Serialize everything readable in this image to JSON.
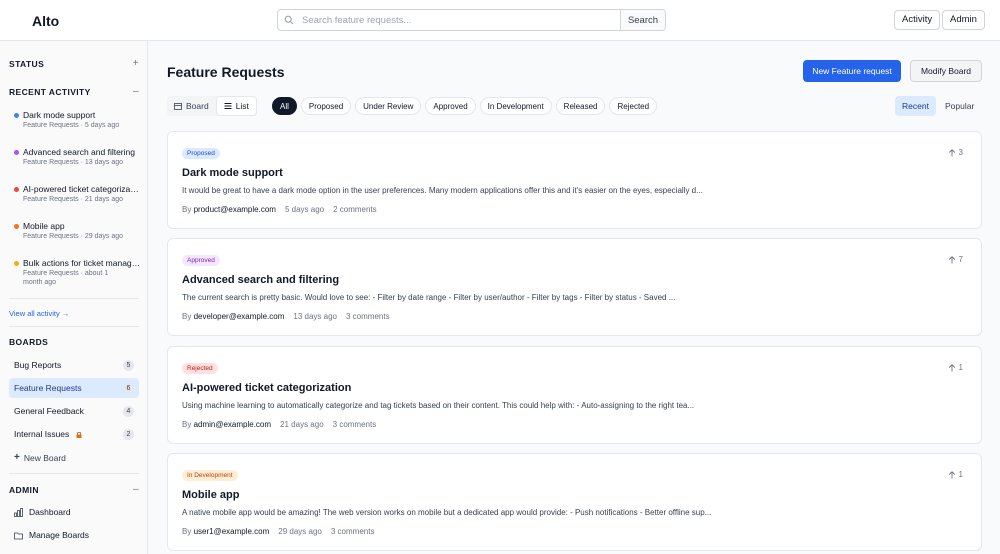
{
  "header": {
    "logo": "Alto",
    "search_placeholder": "Search feature requests...",
    "search_button": "Search",
    "activity_button": "Activity",
    "admin_button": "Admin"
  },
  "sidebar": {
    "status_label": "STATUS",
    "status_toggle": "+",
    "recent_label": "RECENT ACTIVITY",
    "recent_toggle": "–",
    "activity": [
      {
        "title": "Dark mode support",
        "sub": "Feature Requests · 5 days ago",
        "color": "#3b82f6"
      },
      {
        "title": "Advanced search and filtering",
        "sub": "Feature Requests · 13 days ago",
        "color": "#a855f7"
      },
      {
        "title": "AI-powered ticket categorization",
        "sub": "Feature Requests · 21 days ago",
        "color": "#ef4444"
      },
      {
        "title": "Mobile app",
        "sub": "Feature Requests · 29 days ago",
        "color": "#f97316"
      },
      {
        "title": "Bulk actions for ticket management",
        "sub": "Feature Requests · about 1 month ago",
        "color": "#eab308"
      }
    ],
    "view_all": "View all activity →",
    "boards_label": "BOARDS",
    "boards": [
      {
        "name": "Bug Reports",
        "count": "5"
      },
      {
        "name": "Feature Requests",
        "count": "6"
      },
      {
        "name": "General Feedback",
        "count": "4"
      },
      {
        "name": "Internal Issues",
        "count": "2"
      }
    ],
    "new_board": "New Board",
    "admin_label": "ADMIN",
    "admin_toggle": "–",
    "admin_items": [
      {
        "label": "Dashboard"
      },
      {
        "label": "Manage Boards"
      }
    ]
  },
  "main": {
    "title": "Feature Requests",
    "new_button": "New Feature request",
    "modify_button": "Modify Board",
    "view_board": "Board",
    "view_list": "List",
    "filters": [
      "All",
      "Proposed",
      "Under Review",
      "Approved",
      "In Development",
      "Released",
      "Rejected"
    ],
    "sort_recent": "Recent",
    "sort_popular": "Popular",
    "cards": [
      {
        "status": "Proposed",
        "status_bg": "#dbeafe",
        "status_fg": "#1d4ed8",
        "title": "Dark mode support",
        "desc": "It would be great to have a dark mode option in the user preferences. Many modern applications offer this and it's easier on the eyes, especially d...",
        "author": "product@example.com",
        "time": "5 days ago",
        "comments": "2 comments",
        "votes": "3"
      },
      {
        "status": "Approved",
        "status_bg": "#f3e8ff",
        "status_fg": "#7e22ce",
        "title": "Advanced search and filtering",
        "desc": "The current search is pretty basic. Would love to see: - Filter by date range - Filter by user/author - Filter by tags - Filter by status - Saved ...",
        "author": "developer@example.com",
        "time": "13 days ago",
        "comments": "3 comments",
        "votes": "7"
      },
      {
        "status": "Rejected",
        "status_bg": "#fee2e2",
        "status_fg": "#b91c1c",
        "title": "AI-powered ticket categorization",
        "desc": "Using machine learning to automatically categorize and tag tickets based on their content. This could help with: - Auto-assigning to the right tea...",
        "author": "admin@example.com",
        "time": "21 days ago",
        "comments": "3 comments",
        "votes": "1"
      },
      {
        "status": "In Development",
        "status_bg": "#ffedd5",
        "status_fg": "#c2410c",
        "title": "Mobile app",
        "desc": "A native mobile app would be amazing! The web version works on mobile but a dedicated app would provide: - Push notifications - Better offline sup...",
        "author": "user1@example.com",
        "time": "29 days ago",
        "comments": "3 comments",
        "votes": "1"
      }
    ]
  }
}
